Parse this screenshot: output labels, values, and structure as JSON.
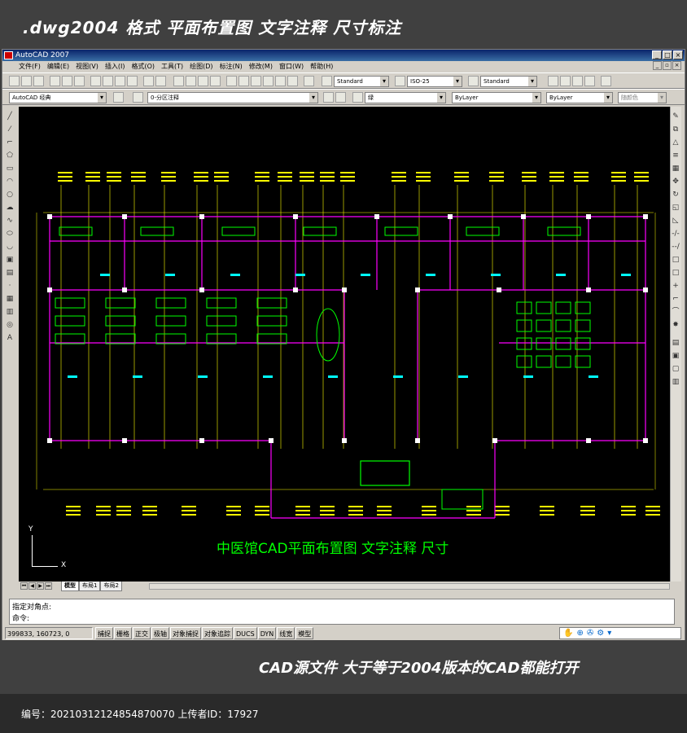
{
  "banner_top": ".dwg2004 格式  平面布置图 文字注释 尺寸标注",
  "window": {
    "title": "AutoCAD 2007"
  },
  "menu": [
    "文件(F)",
    "编辑(E)",
    "视图(V)",
    "插入(I)",
    "格式(O)",
    "工具(T)",
    "绘图(D)",
    "标注(N)",
    "修改(M)",
    "窗口(W)",
    "帮助(H)"
  ],
  "toolbar": {
    "text_style": "Standard",
    "dim_style": "ISO-25",
    "table_style": "Standard",
    "workspace": "AutoCAD 经典",
    "layer": "0-分区注释",
    "color": "绿",
    "linetype": "ByLayer",
    "lineweight": "ByLayer",
    "plot_style": "随颜色"
  },
  "drawing": {
    "caption": "中医馆CAD平面布置图    文字注释    尺寸",
    "ucs_y": "Y",
    "ucs_x": "X"
  },
  "layout_tabs": [
    "模型",
    "布局1",
    "布局2"
  ],
  "command": {
    "line1": "指定对角点:",
    "line2": "命令:"
  },
  "status": {
    "coords": "399833, 160723, 0",
    "toggles": [
      "捕捉",
      "栅格",
      "正交",
      "极轴",
      "对象捕捉",
      "对象追踪",
      "DUCS",
      "DYN",
      "线宽",
      "模型"
    ]
  },
  "banner_bottom": "CAD源文件  大于等于2004版本的CAD都能打开",
  "footer": "编号：20210312124854870070 上传者ID：17927",
  "colors": {
    "canvas": "#000000",
    "wall": "#ff00ff",
    "furniture": "#00ff00",
    "dim": "#ffff00",
    "label": "#00ffff"
  }
}
